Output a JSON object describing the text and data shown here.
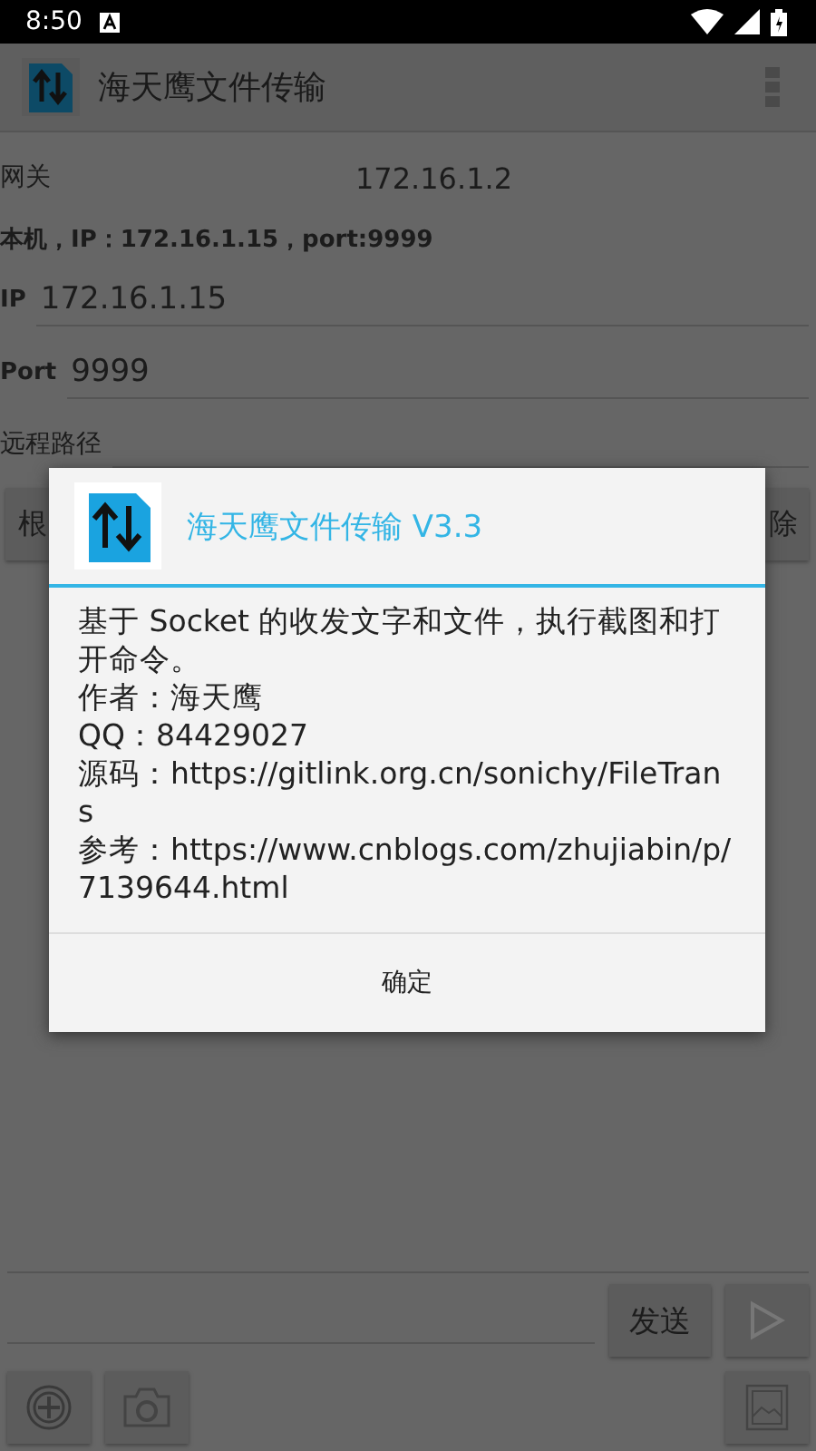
{
  "status_bar": {
    "time": "8:50"
  },
  "app_bar": {
    "title": "海天鹰文件传输"
  },
  "gateway": {
    "label": "网关",
    "value": "172.16.1.2"
  },
  "local_info": "本机，IP：172.16.1.15，port:9999",
  "ip_field": {
    "label": "IP",
    "value": "172.16.1.15"
  },
  "port_field": {
    "label": "Port",
    "value": "9999"
  },
  "remote_path": {
    "label": "远程路径"
  },
  "path_buttons": [
    "根",
    "除"
  ],
  "send_button": "发送",
  "dialog": {
    "title": "海天鹰文件传输 V3.3",
    "lines": [
      "基于 Socket 的收发文字和文件，执行截图和打开命令。",
      "作者：海天鹰",
      "QQ：84429027",
      "源码：https://gitlink.org.cn/sonichy/FileTrans",
      "参考：https://www.cnblogs.com/zhujiabin/p/7139644.html"
    ],
    "button": "确定"
  }
}
